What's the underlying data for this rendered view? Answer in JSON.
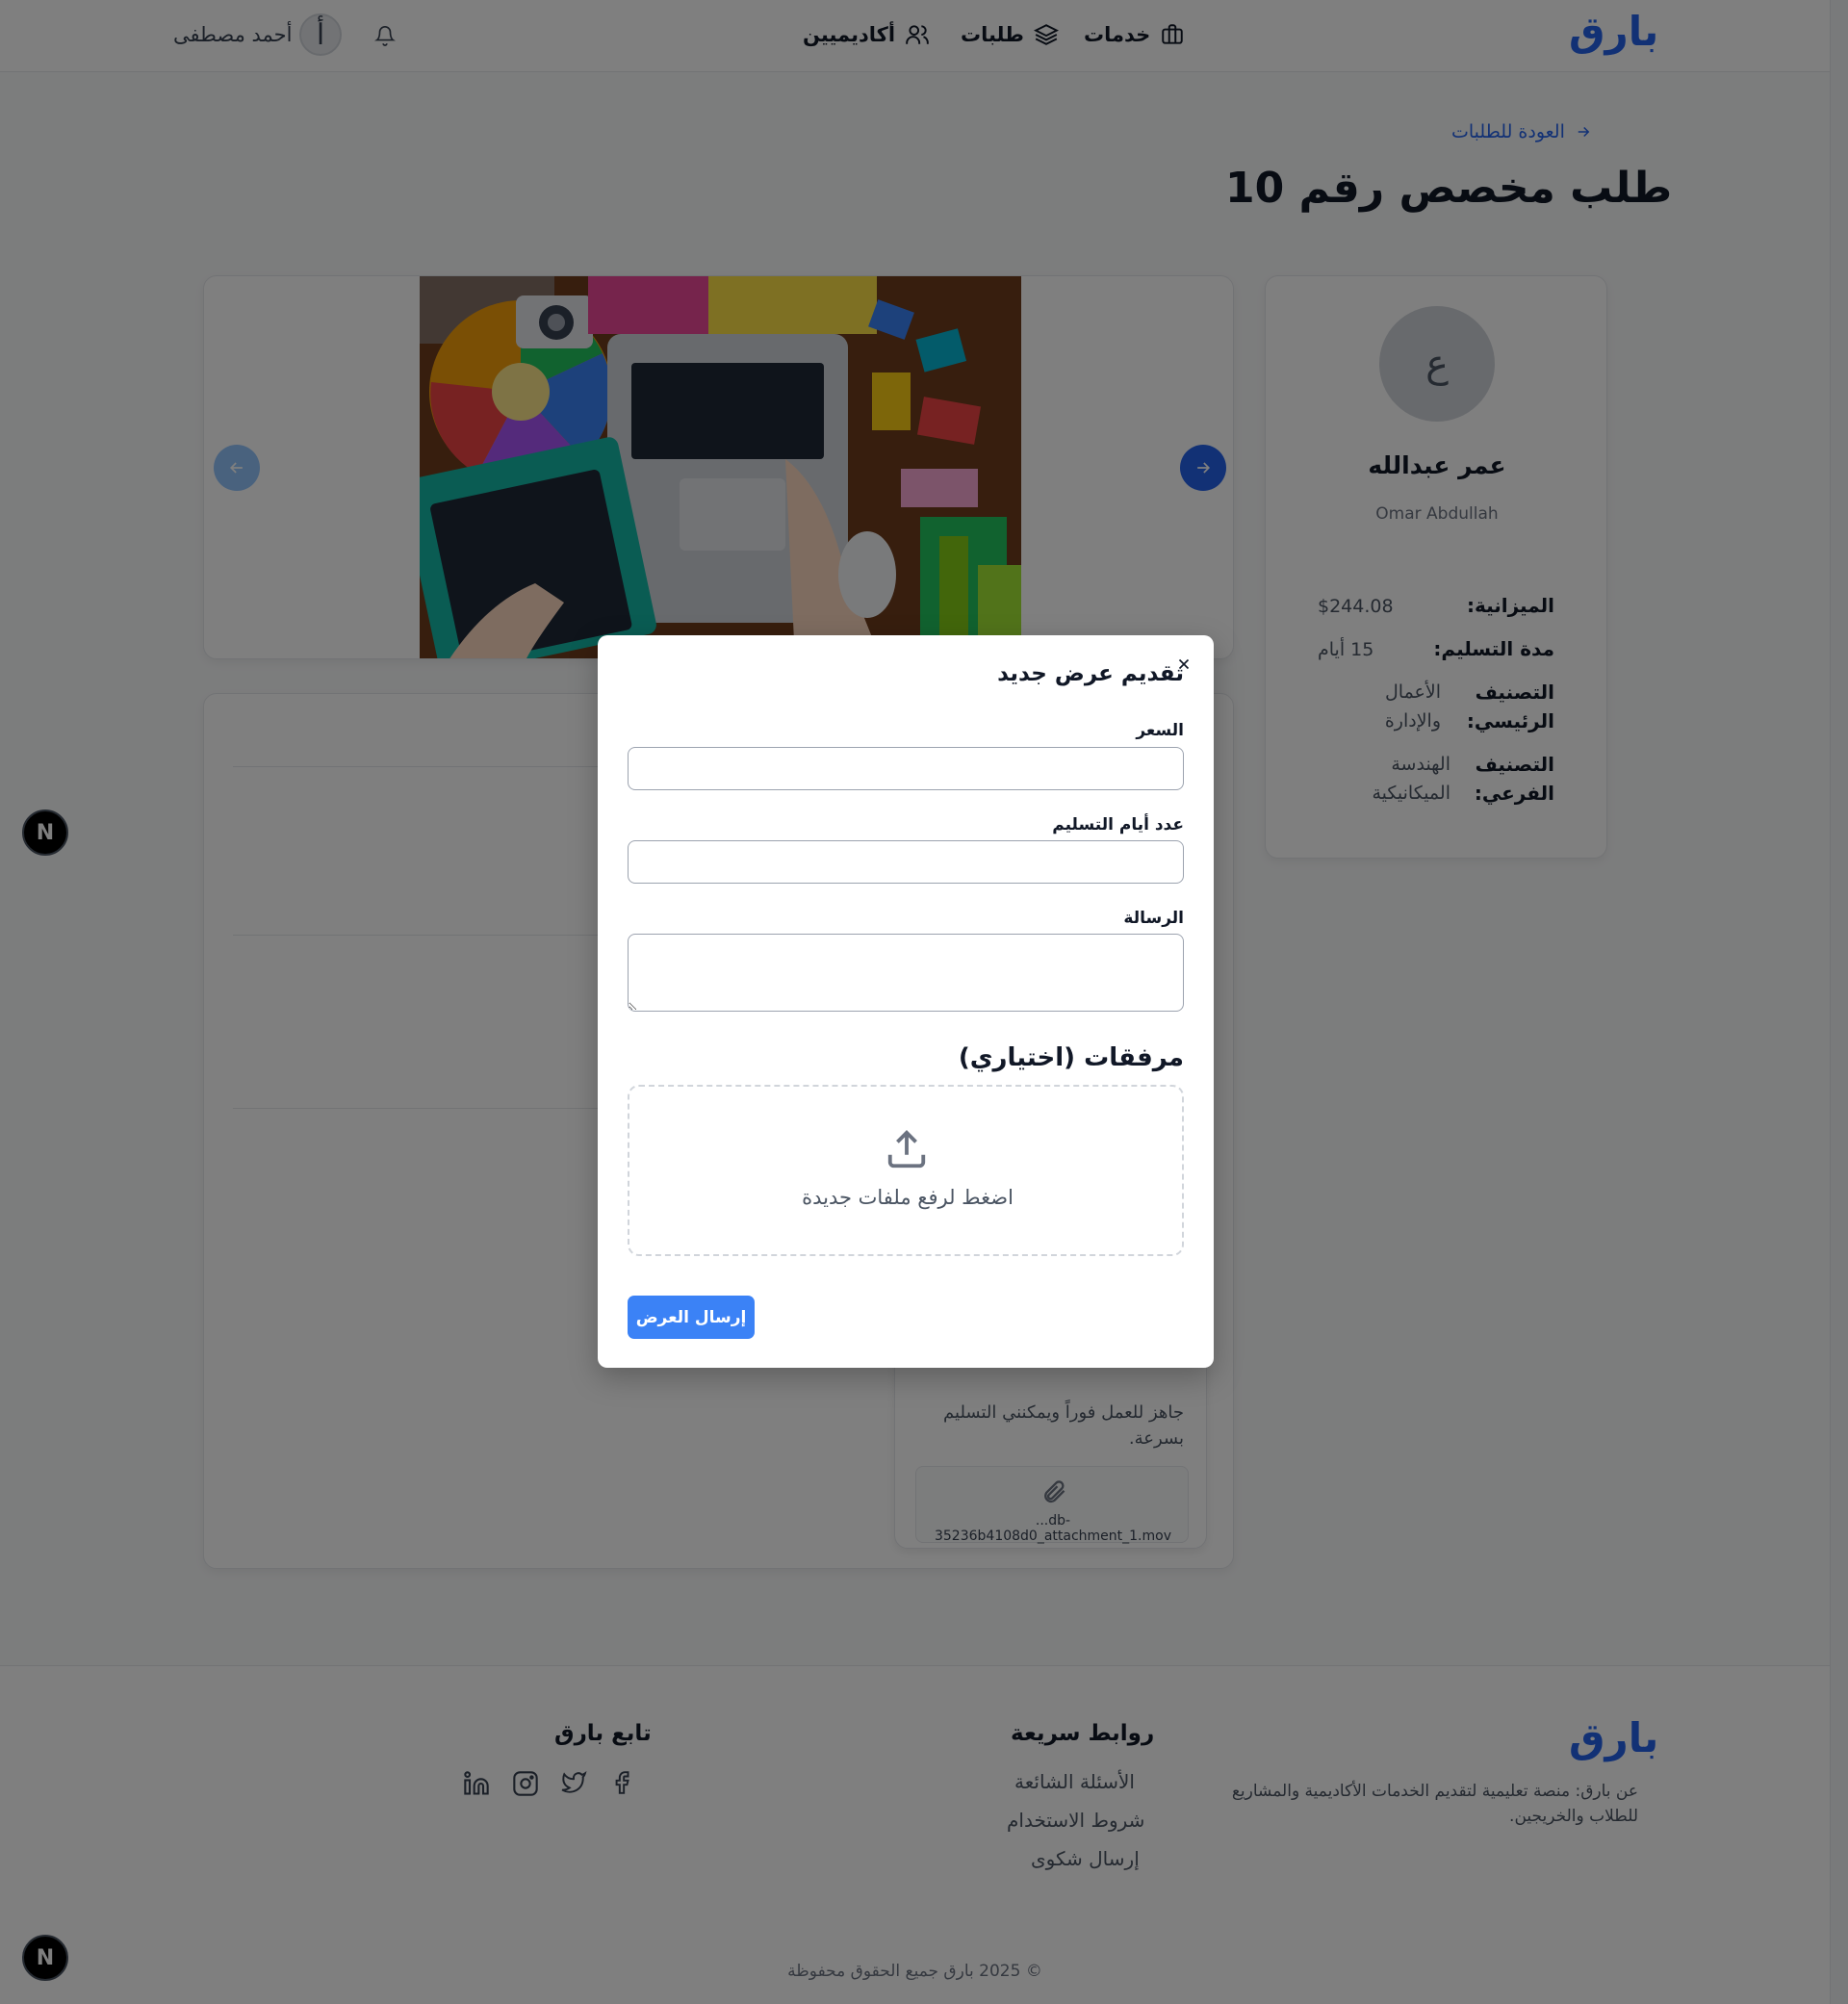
{
  "header": {
    "logo": "بارق",
    "nav": [
      {
        "label": "خدمات",
        "icon": "briefcase-icon"
      },
      {
        "label": "طلبات",
        "icon": "layers-icon"
      },
      {
        "label": "أكاديميين",
        "icon": "users-icon"
      }
    ],
    "user": {
      "name": "أحمد مصطفى",
      "avatar_letter": "أ"
    },
    "bell_icon": "bell-icon"
  },
  "back_link": "العودة للطلبات",
  "page_title": "طلب مخصص رقم 10",
  "profile": {
    "avatar_letter": "ع",
    "name": "عمر عبدالله",
    "name_en": "Omar Abdullah",
    "details": [
      {
        "label": "الميزانية:",
        "value": "$244.08"
      },
      {
        "label": "مدة التسليم:",
        "value": "15 أيام"
      },
      {
        "label": "التصنيف الرئيسي:",
        "value": "الأعمال والإدارة"
      },
      {
        "label": "التصنيف الفرعي:",
        "value": "الهندسة الميكانيكية"
      }
    ]
  },
  "offer_peek": {
    "message": "جاهز للعمل فوراً ويمكنني التسليم بسرعة.",
    "attachment": "...db-35236b4108d0_attachment_1.mov"
  },
  "modal": {
    "title": "تقديم عرض جديد",
    "price_label": "السعر",
    "price_value": "",
    "days_label": "عدد أيام التسليم",
    "days_value": "",
    "message_label": "الرسالة",
    "message_value": "",
    "attachments_title": "مرفقات (اختياري)",
    "upload_text": "اضغط لرفع ملفات جديدة",
    "submit_label": "إرسال العرض"
  },
  "footer": {
    "logo": "بارق",
    "about": "عن بارق: منصة تعليمية لتقديم الخدمات الأكاديمية والمشاريع للطلاب والخريجين.",
    "quick_links_title": "روابط سريعة",
    "quick_links": [
      "الأسئلة الشائعة",
      "شروط الاستخدام",
      "إرسال شكوى"
    ],
    "follow_title": "تابع بارق",
    "social_icons": [
      "facebook-icon",
      "twitter-icon",
      "instagram-icon",
      "linkedin-icon"
    ],
    "copyright": "© 2025 بارق جميع الحقوق محفوظة"
  },
  "dev_badge": "N",
  "colors": {
    "brand": "#2563eb",
    "button": "#3b82f6",
    "overlay": "rgba(0,0,0,0.5)"
  }
}
